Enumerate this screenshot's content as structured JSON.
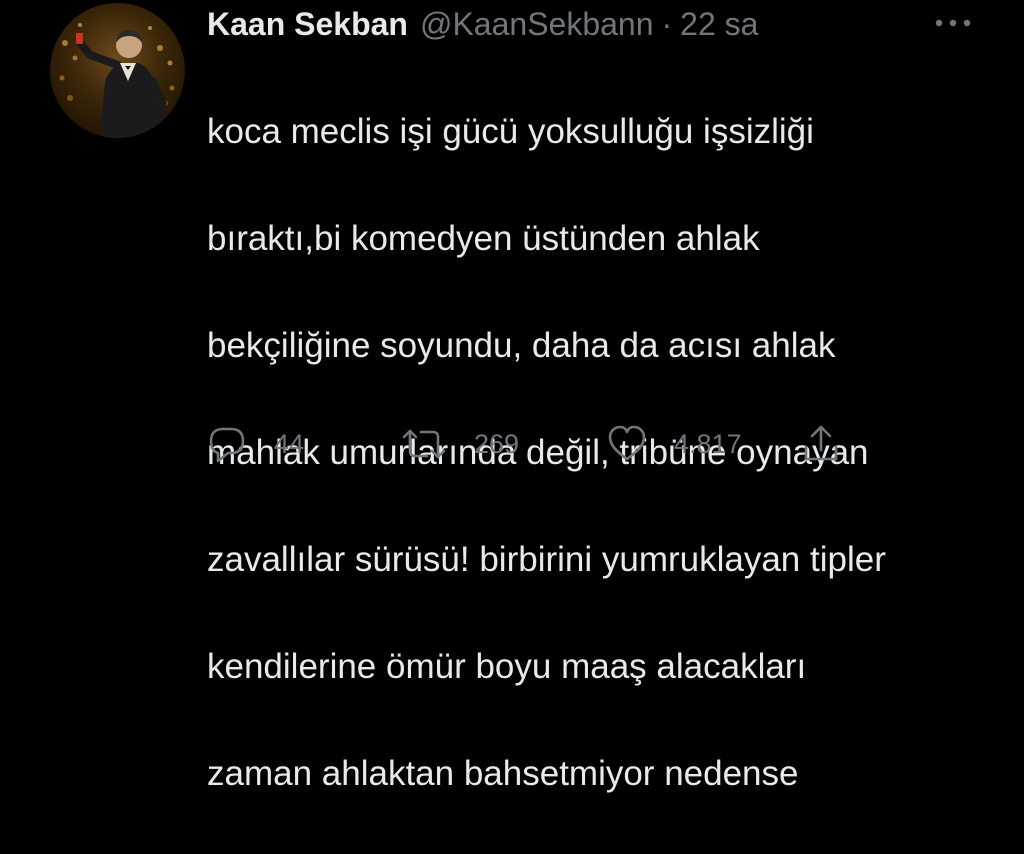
{
  "tweet": {
    "author": {
      "display_name": "Kaan Sekban",
      "handle": "@KaanSekbann",
      "separator": "·",
      "time": "22 sa"
    },
    "avatar_icon": "profile-photo",
    "more_icon": "more-horizontal-icon",
    "text_lines": [
      "koca meclis işi gücü yoksulluğu işsizliği",
      "bıraktı,bi komedyen üstünden ahlak",
      "bekçiliğine soyundu, daha da acısı ahlak",
      "mahlak umurlarında değil, tribüne oynayan",
      "zavallılar sürüsü! birbirini yumruklayan tipler",
      "kendilerine ömür boyu maaş alacakları",
      "zaman ahlaktan bahsetmiyor nedense"
    ],
    "actions": {
      "reply": {
        "icon": "reply-icon",
        "count": "44"
      },
      "retweet": {
        "icon": "retweet-icon",
        "count": "269"
      },
      "like": {
        "icon": "heart-icon",
        "count": "4.817"
      },
      "share": {
        "icon": "share-icon"
      }
    }
  },
  "colors": {
    "background": "#000000",
    "primary_text": "#e7e9ea",
    "secondary_text": "#71767b"
  }
}
